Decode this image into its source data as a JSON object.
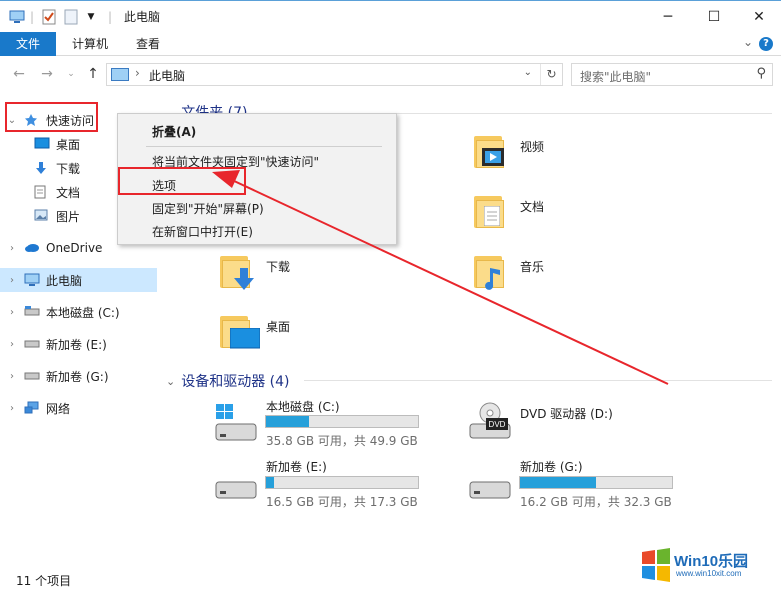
{
  "window": {
    "title": "此电脑"
  },
  "ribbon": {
    "tabs": [
      "文件",
      "计算机",
      "查看"
    ],
    "help": "?"
  },
  "address": {
    "crumb": "此电脑",
    "search_placeholder": "搜索\"此电脑\""
  },
  "sidebar": {
    "quick_access": "快速访问",
    "quick_items": [
      "桌面",
      "下载",
      "文档",
      "图片"
    ],
    "onedrive": "OneDrive",
    "this_pc": "此电脑",
    "drives": [
      "本地磁盘 (C:)",
      "新加卷 (E:)",
      "新加卷 (G:)"
    ],
    "network": "网络"
  },
  "groups": {
    "folders": "文件夹 (7)",
    "devices": "设备和驱动器 (4)"
  },
  "folders": {
    "video": "视频",
    "docs": "文档",
    "download": "下载",
    "music": "音乐",
    "desktop": "桌面"
  },
  "drives": [
    {
      "name": "本地磁盘 (C:)",
      "free": "35.8 GB 可用，共 49.9 GB",
      "used_fraction": 0.28
    },
    {
      "name": "DVD 驱动器 (D:)"
    },
    {
      "name": "新加卷 (E:)",
      "free": "16.5 GB 可用，共 17.3 GB",
      "used_fraction": 0.05
    },
    {
      "name": "新加卷 (G:)",
      "free": "16.2 GB 可用，共 32.3 GB",
      "used_fraction": 0.5
    }
  ],
  "context_menu": {
    "items": [
      "折叠(A)",
      "将当前文件夹固定到\"快速访问\"",
      "选项",
      "固定到\"开始\"屏幕(P)",
      "在新窗口中打开(E)"
    ]
  },
  "status": {
    "count": "11 个项目"
  },
  "watermark": {
    "brand": "Win10乐园",
    "url": "www.win10xit.com",
    "dvd_badge": "DVD"
  },
  "colors": {
    "accent": "#1979ca",
    "annotation": "#e8262c"
  }
}
